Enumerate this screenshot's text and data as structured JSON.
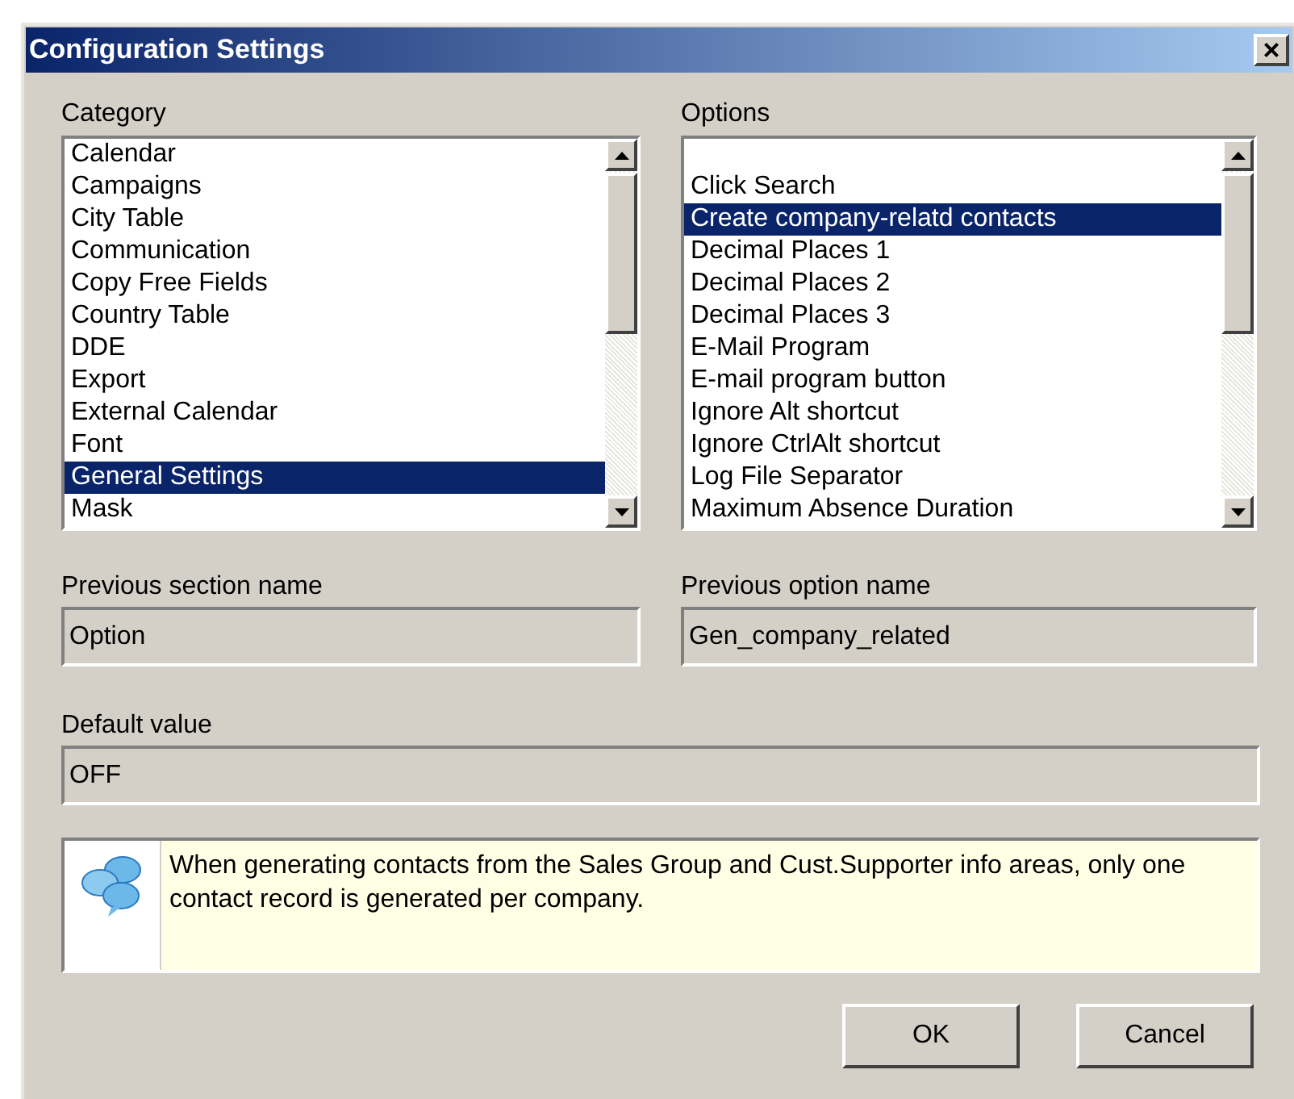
{
  "window": {
    "title": "Configuration Settings",
    "close": "×"
  },
  "category": {
    "label": "Category",
    "items": [
      {
        "text": "Calendar",
        "selected": false
      },
      {
        "text": "Campaigns",
        "selected": false
      },
      {
        "text": "City Table",
        "selected": false
      },
      {
        "text": "Communication",
        "selected": false
      },
      {
        "text": "Copy Free Fields",
        "selected": false
      },
      {
        "text": "Country Table",
        "selected": false
      },
      {
        "text": "DDE",
        "selected": false
      },
      {
        "text": "Export",
        "selected": false
      },
      {
        "text": "External Calendar",
        "selected": false
      },
      {
        "text": "Font",
        "selected": false
      },
      {
        "text": "General Settings",
        "selected": true
      },
      {
        "text": "Mask",
        "selected": false
      }
    ]
  },
  "options": {
    "label": "Options",
    "items": [
      {
        "text": "Click Search",
        "selected": false
      },
      {
        "text": "Create company-relatd contacts",
        "selected": true
      },
      {
        "text": "Decimal Places 1",
        "selected": false
      },
      {
        "text": "Decimal Places 2",
        "selected": false
      },
      {
        "text": "Decimal Places 3",
        "selected": false
      },
      {
        "text": "E-Mail Program",
        "selected": false
      },
      {
        "text": "E-mail program button",
        "selected": false
      },
      {
        "text": "Ignore Alt shortcut",
        "selected": false
      },
      {
        "text": "Ignore CtrlAlt shortcut",
        "selected": false
      },
      {
        "text": "Log File Separator",
        "selected": false
      },
      {
        "text": "Maximum Absence Duration",
        "selected": false
      }
    ]
  },
  "previous_section_name": {
    "label": "Previous section name",
    "value": "Option"
  },
  "previous_option_name": {
    "label": "Previous option name",
    "value": "Gen_company_related"
  },
  "default_value": {
    "label": "Default value",
    "value": "OFF"
  },
  "help_text": "When generating contacts from the Sales Group and Cust.Supporter info areas, only one contact record is generated per company.",
  "buttons": [
    "OK",
    "Cancel"
  ]
}
